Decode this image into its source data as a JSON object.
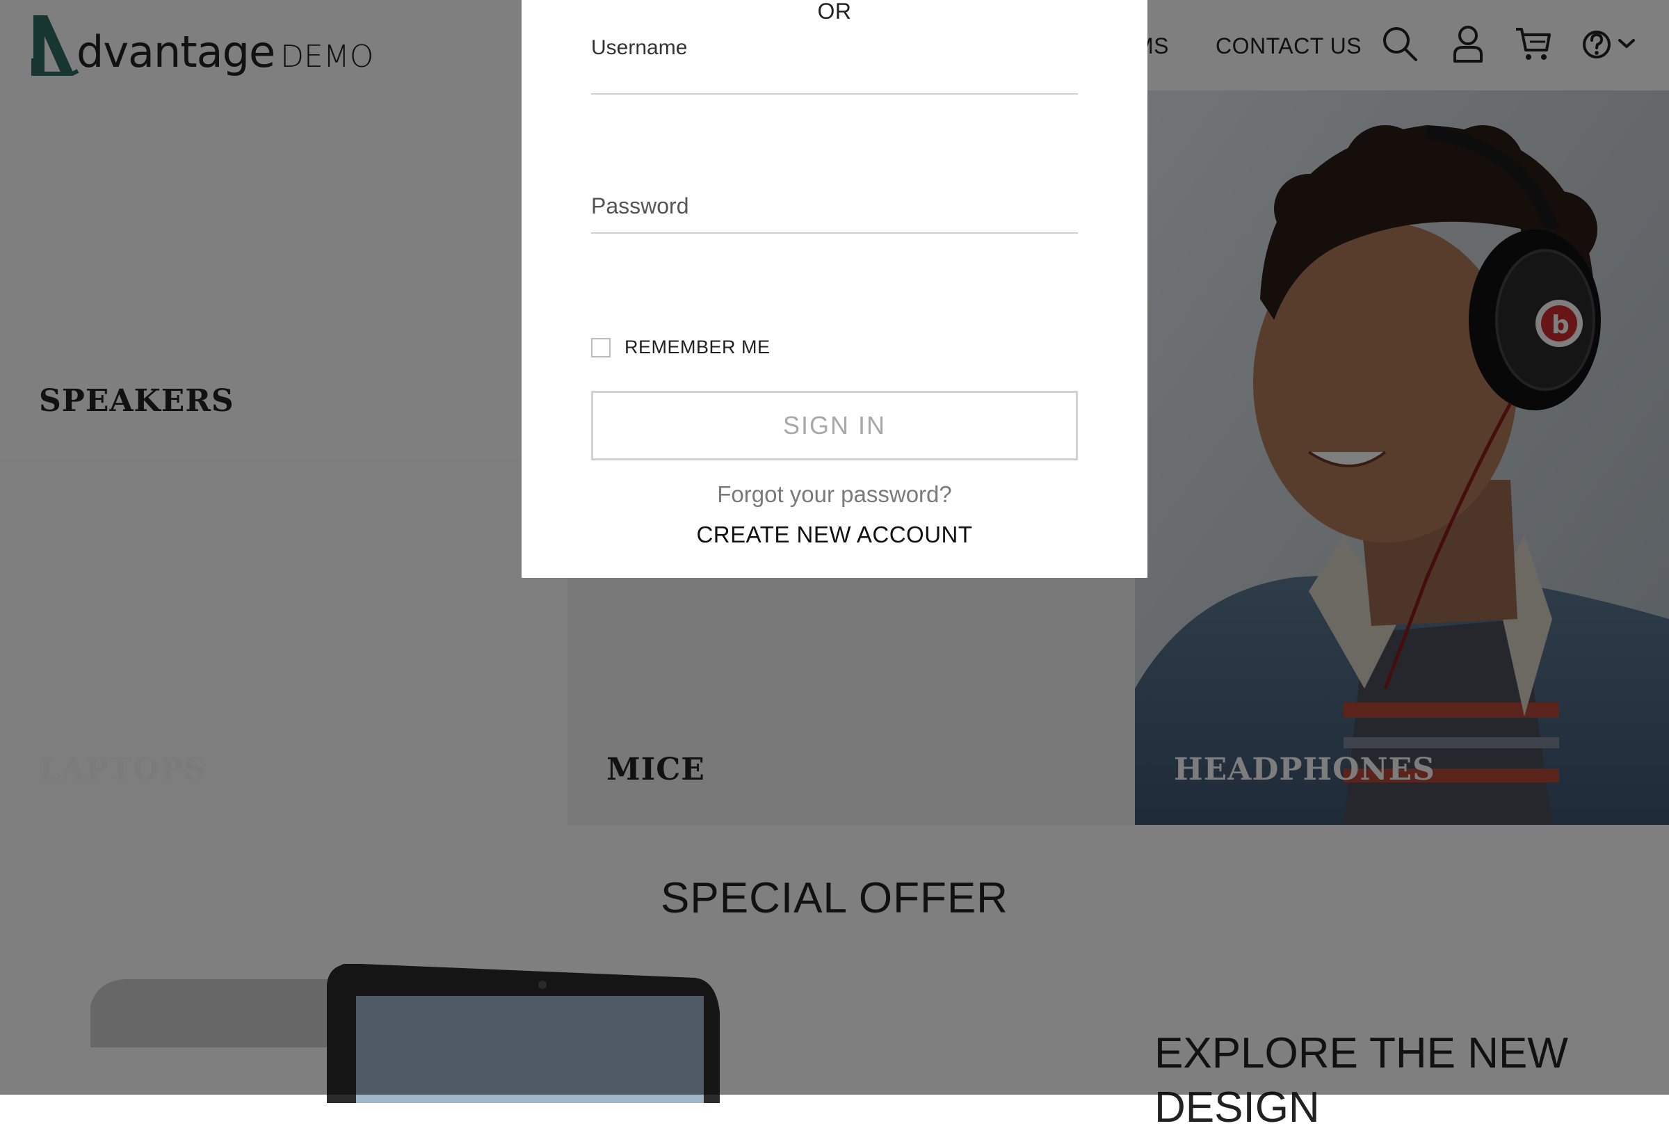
{
  "header": {
    "logo_word": "dvantage",
    "logo_demo": "DEMO",
    "nav_partial": "MS",
    "nav_contact": "CONTACT US",
    "icons": [
      "search-icon",
      "user-icon",
      "cart-icon",
      "help-icon",
      "chevron-down-icon"
    ]
  },
  "categories": {
    "speakers": "SPEAKERS",
    "laptops": "LAPTOPS",
    "mice": "MICE",
    "headphones": "HEADPHONES"
  },
  "offer": {
    "title": "SPECIAL OFFER",
    "subtitle": "EXPLORE THE NEW DESIGN"
  },
  "login_modal": {
    "or": "OR",
    "username_label": "Username",
    "password_label": "Password",
    "remember_me": "REMEMBER ME",
    "remember_checked": false,
    "sign_in": "SIGN IN",
    "forgot": "Forgot your password?",
    "create_account": "CREATE NEW ACCOUNT"
  },
  "colors": {
    "logo_teal": "#2f6b63",
    "overlay": "rgba(0,0,0,0.5)",
    "signin_border": "#d2d2d2"
  }
}
